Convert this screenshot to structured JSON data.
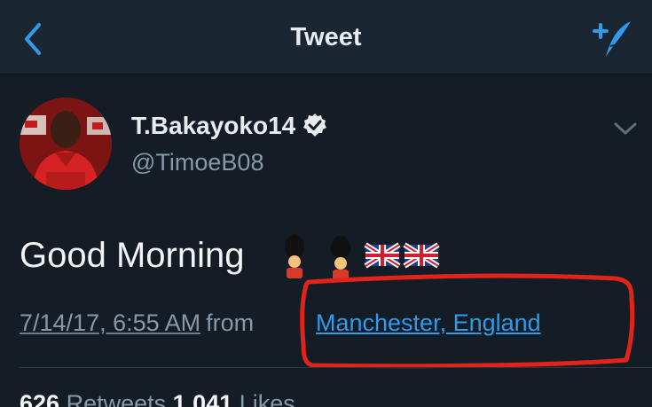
{
  "nav": {
    "title": "Tweet",
    "back_icon": "chevron-left-icon",
    "compose_icon": "compose-tweet-icon"
  },
  "tweet": {
    "display_name": "T.Bakayoko14",
    "handle": "@TimoeB08",
    "verified_icon": "verified-badge-icon",
    "more_icon": "chevron-down-icon",
    "text": "Good Morning",
    "emojis": [
      "guardsman",
      "guardsman",
      "uk-flag",
      "uk-flag"
    ],
    "timestamp": "7/14/17, 6:55 AM",
    "from_label": "from",
    "location": "Manchester, England",
    "retweets_count": "626",
    "retweets_label": "Retweets",
    "likes_count": "1,041",
    "likes_label": "Likes"
  },
  "colors": {
    "background": "#141c26",
    "navbar": "#1b2633",
    "link": "#2f9bea",
    "secondary_text": "#8899a6",
    "annotation": "#e2231a"
  }
}
